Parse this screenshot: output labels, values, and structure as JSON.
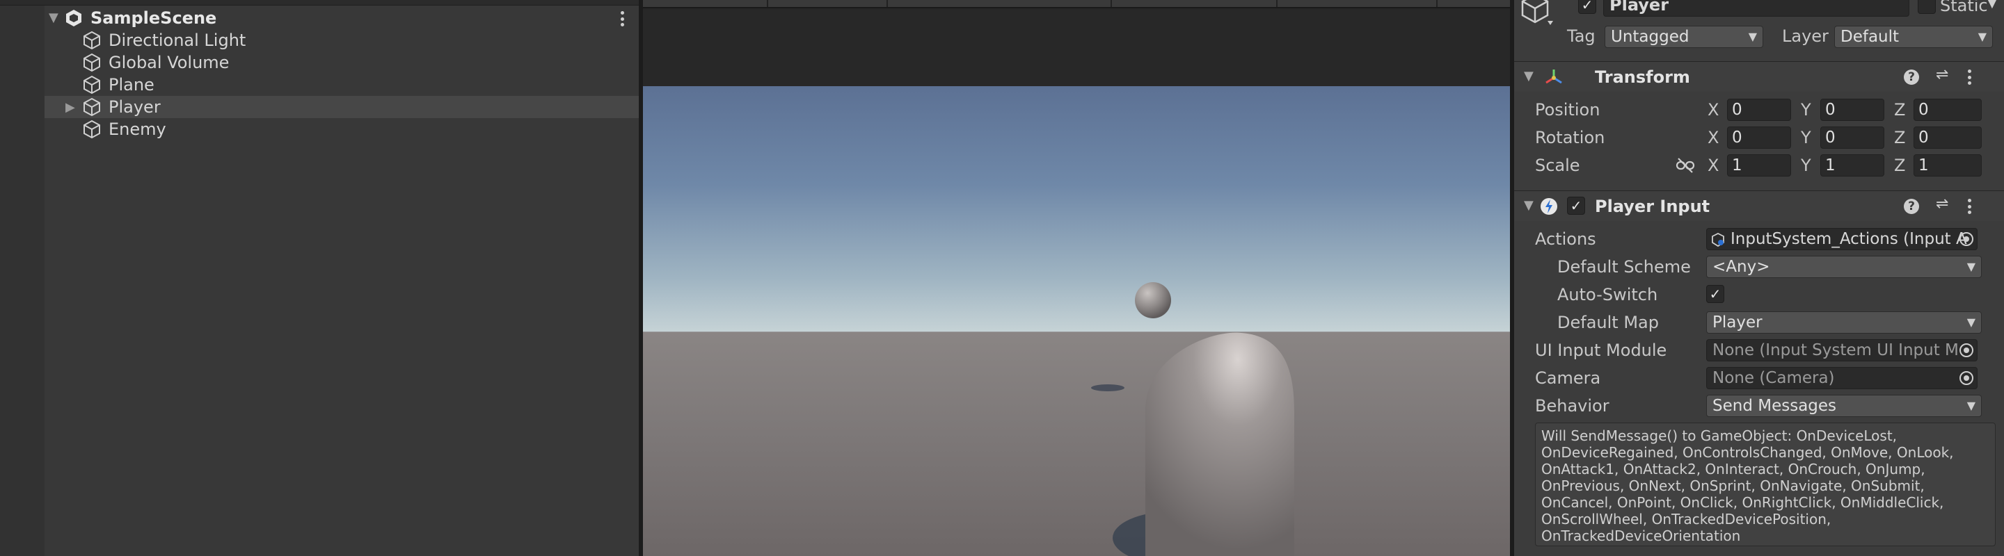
{
  "hierarchy": {
    "scene": "SampleScene",
    "items": [
      {
        "label": "Directional Light"
      },
      {
        "label": "Global Volume"
      },
      {
        "label": "Plane"
      },
      {
        "label": "Player"
      },
      {
        "label": "Enemy"
      }
    ]
  },
  "inspector": {
    "object_name": "Player",
    "static_label": "Static",
    "tag_label": "Tag",
    "tag_value": "Untagged",
    "layer_label": "Layer",
    "layer_value": "Default",
    "transform": {
      "title": "Transform",
      "position": {
        "label": "Position",
        "x": "0",
        "y": "0",
        "z": "0"
      },
      "rotation": {
        "label": "Rotation",
        "x": "0",
        "y": "0",
        "z": "0"
      },
      "scale": {
        "label": "Scale",
        "x": "1",
        "y": "1",
        "z": "1"
      },
      "axis_x": "X",
      "axis_y": "Y",
      "axis_z": "Z"
    },
    "player_input": {
      "title": "Player Input",
      "actions_label": "Actions",
      "actions_value": "InputSystem_Actions (Input A",
      "default_scheme_label": "Default Scheme",
      "default_scheme_value": "<Any>",
      "auto_switch_label": "Auto-Switch",
      "default_map_label": "Default Map",
      "default_map_value": "Player",
      "ui_input_label": "UI Input Module",
      "ui_input_value": "None (Input System UI Input M",
      "camera_label": "Camera",
      "camera_value": "None (Camera)",
      "behavior_label": "Behavior",
      "behavior_value": "Send Messages",
      "help_text": "Will SendMessage() to GameObject: OnDeviceLost, OnDeviceRegained, OnControlsChanged, OnMove, OnLook, OnAttack1, OnAttack2, OnInteract, OnCrouch, OnJump, OnPrevious, OnNext, OnSprint, OnNavigate, OnSubmit, OnCancel, OnPoint, OnClick, OnRightClick, OnMiddleClick, OnScrollWheel, OnTrackedDevicePosition, OnTrackedDeviceOrientation"
    }
  }
}
